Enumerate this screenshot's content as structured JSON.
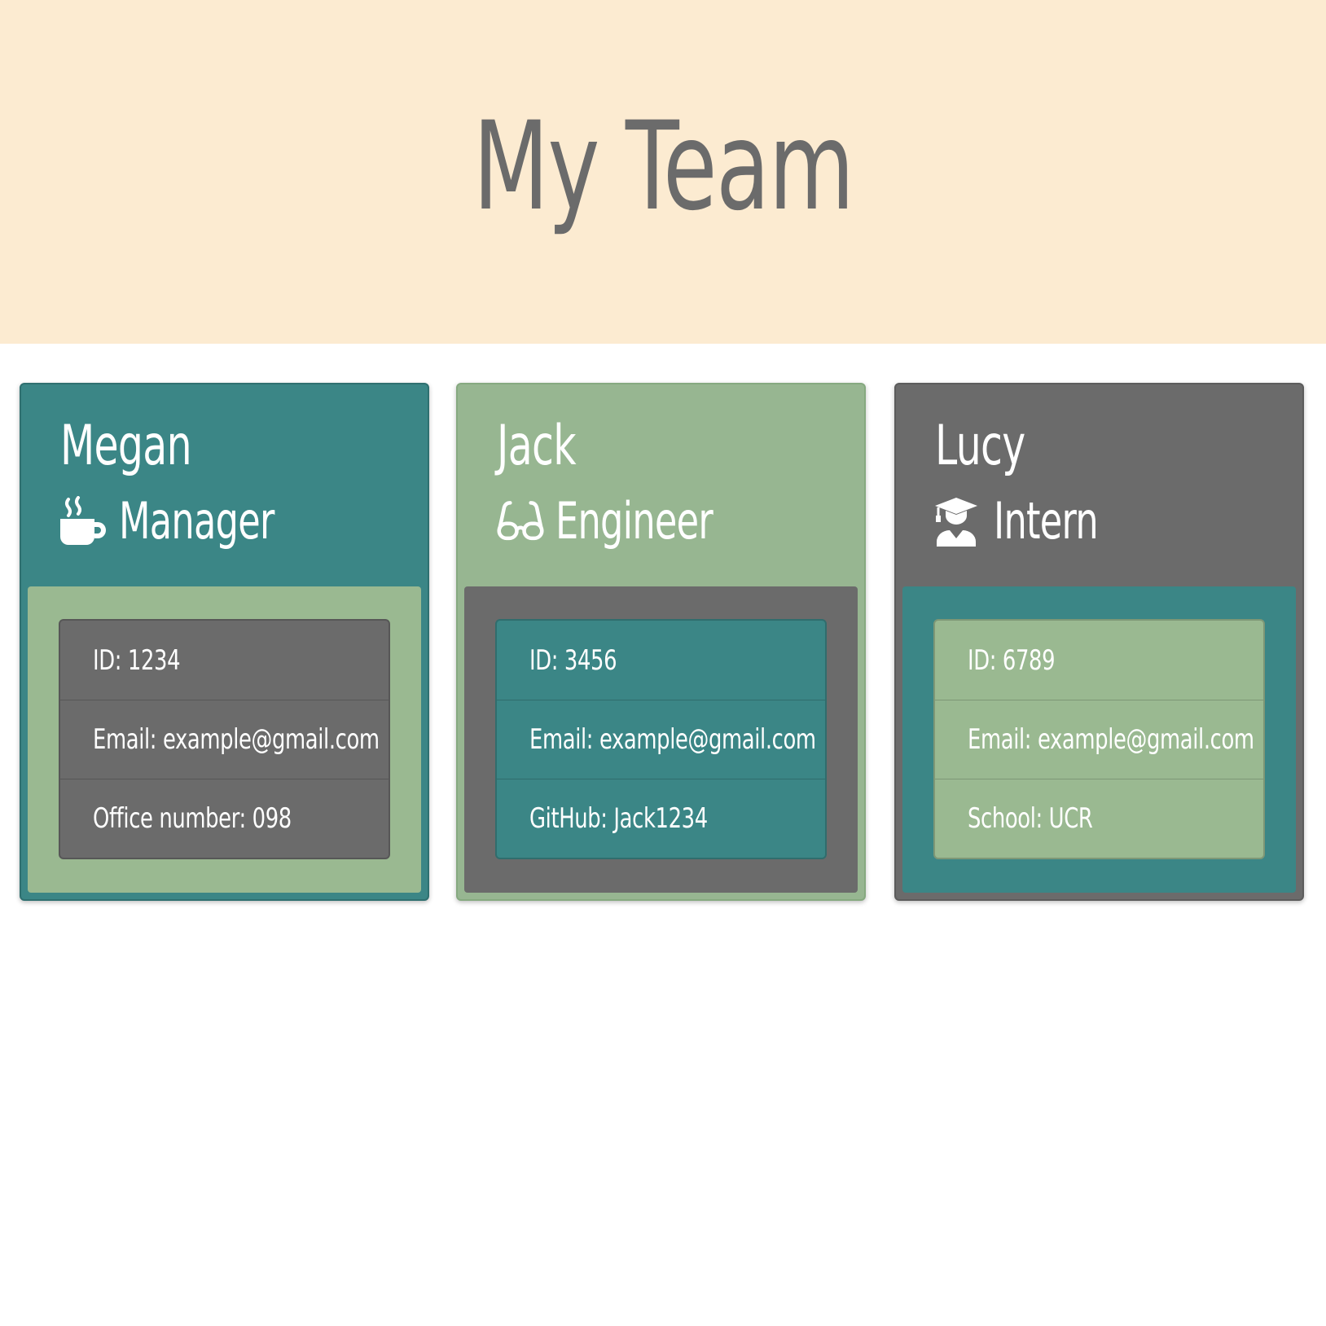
{
  "header": {
    "title": "My Team"
  },
  "colors": {
    "teal": "#3b8686",
    "sage": "#97b691",
    "gray": "#6b6b6b",
    "header_bg": "#fcebd1"
  },
  "cards": [
    {
      "name": "Megan",
      "role": "Manager",
      "role_icon": "coffee-icon",
      "items": [
        "ID: 1234",
        "Email: example@gmail.com",
        "Office number: 098"
      ]
    },
    {
      "name": "Jack",
      "role": "Engineer",
      "role_icon": "glasses-icon",
      "items": [
        "ID: 3456",
        "Email: example@gmail.com",
        "GitHub: Jack1234"
      ]
    },
    {
      "name": "Lucy",
      "role": "Intern",
      "role_icon": "graduate-icon",
      "items": [
        "ID: 6789",
        "Email: example@gmail.com",
        "School: UCR"
      ]
    }
  ]
}
